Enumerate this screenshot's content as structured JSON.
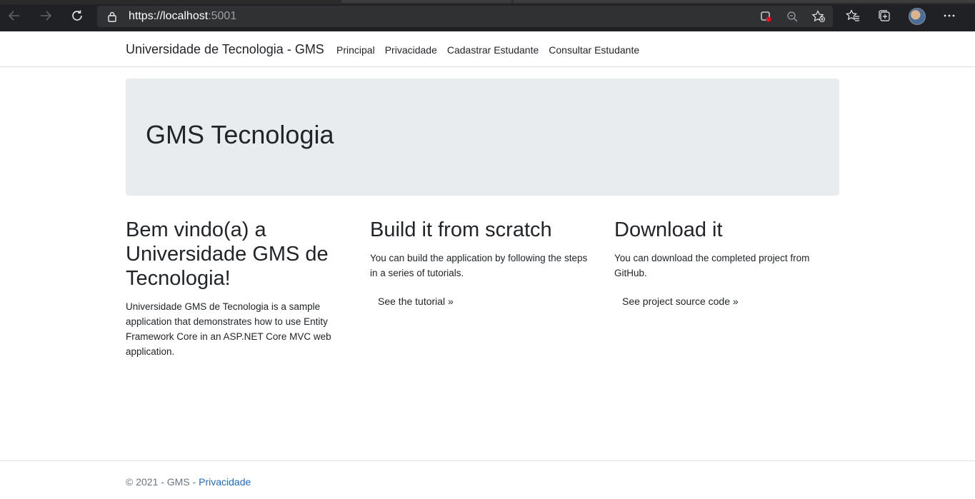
{
  "browser": {
    "url_scheme_host": "https://localhost",
    "url_port": ":5001",
    "icons": {
      "back": "arrow-left-icon",
      "forward": "arrow-right-icon",
      "refresh": "refresh-icon",
      "lock": "lock-icon",
      "tracking": "tracking-prevention-icon",
      "zoom": "zoom-out-icon",
      "add_favorite": "add-favorite-icon",
      "favorites": "favorites-icon",
      "collections": "collections-icon",
      "profile": "profile-avatar",
      "more": "more-icon"
    }
  },
  "navbar": {
    "brand": "Universidade de Tecnologia - GMS",
    "links": [
      "Principal",
      "Privacidade",
      "Cadastrar Estudante",
      "Consultar Estudante"
    ]
  },
  "jumbotron": {
    "title": "GMS Tecnologia"
  },
  "columns": [
    {
      "title": "Bem vindo(a) a Universidade GMS de Tecnologia!",
      "text": "Universidade GMS de Tecnologia is a sample application that demonstrates how to use Entity Framework Core in an ASP.NET Core MVC web application.",
      "link": ""
    },
    {
      "title": "Build it from scratch",
      "text": "You can build the application by following the steps in a series of tutorials.",
      "link": "See the tutorial »"
    },
    {
      "title": "Download it",
      "text": "You can download the completed project from GitHub.",
      "link": "See project source code »"
    }
  ],
  "footer": {
    "text": "© 2021 - GMS - ",
    "link": "Privacidade"
  },
  "colors": {
    "chrome_bg": "#202124",
    "omnibox_bg": "#2f3133",
    "jumbotron_bg": "#e9ecef",
    "link": "#1b6ec2"
  }
}
